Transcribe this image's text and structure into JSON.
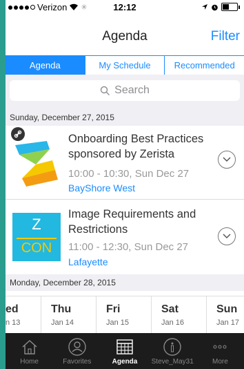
{
  "status": {
    "carrier": "Verizon",
    "time": "12:12",
    "battery_level": 0.45
  },
  "nav": {
    "title": "Agenda",
    "filter_label": "Filter"
  },
  "tabs": [
    {
      "label": "Agenda",
      "active": true
    },
    {
      "label": "My Schedule",
      "active": false
    },
    {
      "label": "Recommended",
      "active": false
    }
  ],
  "search": {
    "placeholder": "Search"
  },
  "sections": [
    {
      "header": "Sunday, December 27, 2015",
      "sessions": [
        {
          "title": "Onboarding Best Practices sponsored by Zerista",
          "time": "10:00 - 10:30, Sun Dec 27",
          "room": "BayShore West"
        },
        {
          "title": "Image Requirements and Restrictions",
          "time": "11:00 - 12:30, Sun Dec 27",
          "room": "Lafayette",
          "logo_text_top": "Z",
          "logo_text_bottom": "CON"
        }
      ]
    },
    {
      "header": "Monday, December 28, 2015"
    }
  ],
  "dates": [
    {
      "day": "ed",
      "date": "n 13"
    },
    {
      "day": "Thu",
      "date": "Jan 14"
    },
    {
      "day": "Fri",
      "date": "Jan 15"
    },
    {
      "day": "Sat",
      "date": "Jan 16"
    },
    {
      "day": "Sun",
      "date": "Jan 17"
    }
  ],
  "tabbar": [
    {
      "label": "Home",
      "icon": "home-icon"
    },
    {
      "label": "Favorites",
      "icon": "person-icon"
    },
    {
      "label": "Agenda",
      "icon": "calendar-icon",
      "active": true
    },
    {
      "label": "Steve_May31",
      "icon": "info-icon"
    },
    {
      "label": "More",
      "icon": "more-icon"
    }
  ],
  "colors": {
    "accent": "#1a8cff",
    "tabbar_bg": "#1c1c1c",
    "frame": "#2a9d8f"
  }
}
